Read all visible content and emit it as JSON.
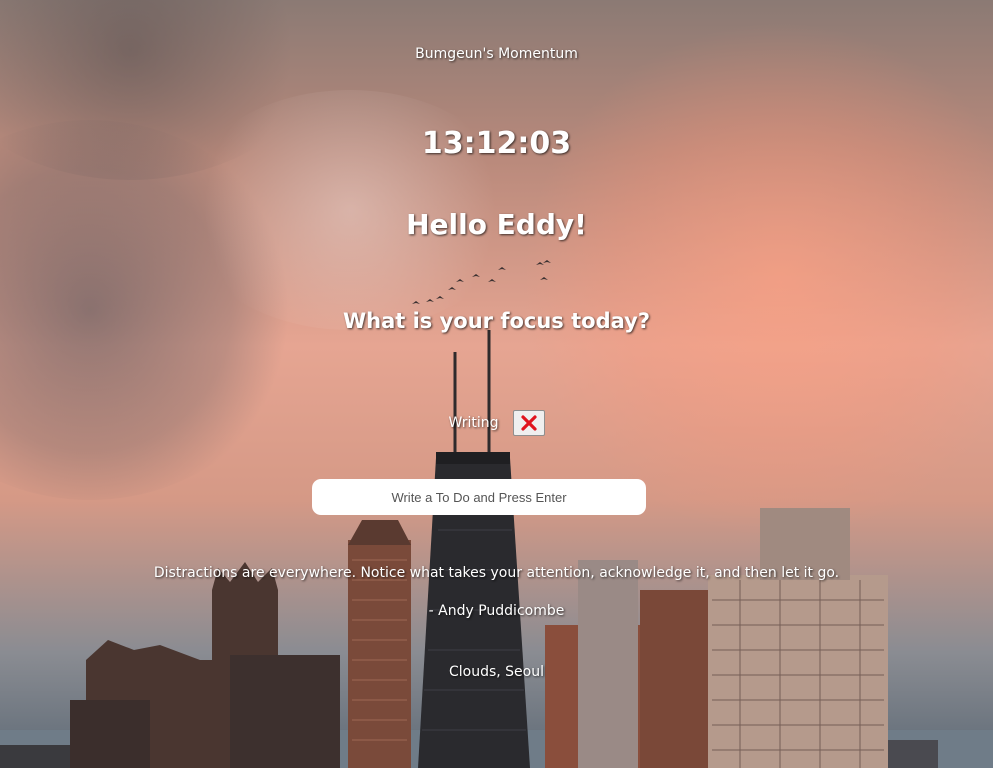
{
  "app": {
    "title": "Bumgeun's Momentum"
  },
  "clock": {
    "time": "13:12:03"
  },
  "greeting": {
    "text": "Hello Eddy!"
  },
  "focus": {
    "question": "What is your focus today?"
  },
  "todos": [
    {
      "text": "Writing",
      "delete_icon": "red-x-icon"
    }
  ],
  "todo_input": {
    "placeholder": "Write a To Do and Press Enter",
    "value": ""
  },
  "quote": {
    "text": "Distractions are everywhere. Notice what takes your attention, acknowledge it, and then let it go.",
    "author": "- Andy Puddicombe"
  },
  "weather": {
    "text": "Clouds, Seoul"
  },
  "colors": {
    "accent_red": "#e0141e",
    "text": "#ffffff",
    "input_bg": "#ffffff"
  }
}
